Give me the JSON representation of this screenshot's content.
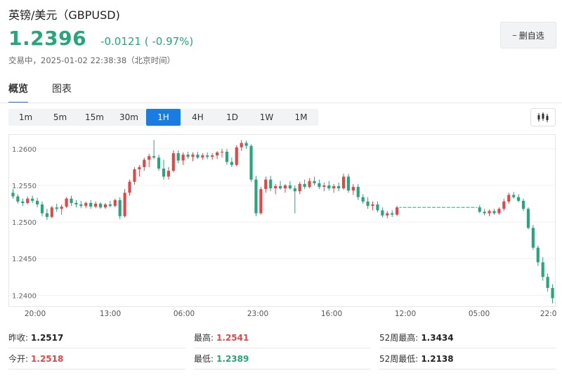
{
  "header": {
    "title": "英镑/美元（GBPUSD)",
    "price": "1.2396",
    "change": "-0.0121 ( -0.97%)",
    "status": "交易中，2025-01-02 22:38:38（北京时间）",
    "watch_button": "删自选",
    "colors": {
      "up": "#e04848",
      "down": "#27a57b",
      "accent": "#1a7be2"
    }
  },
  "tabs": [
    {
      "label": "概览",
      "active": true
    },
    {
      "label": "图表",
      "active": false
    }
  ],
  "periods": [
    "1m",
    "5m",
    "15m",
    "30m",
    "1H",
    "4H",
    "1D",
    "1W",
    "1M"
  ],
  "active_period": "1H",
  "chart_type_icon": "candlestick-icon",
  "chart_data": {
    "type": "candlestick",
    "interval": "1H",
    "ylim": [
      1.2385,
      1.262
    ],
    "y_ticks": [
      "1.2600",
      "1.2550",
      "1.2500",
      "1.2450",
      "1.2400"
    ],
    "x_ticks": [
      "20:00",
      "13:00",
      "06:00",
      "23:00",
      "16:00",
      "12:00",
      "05:00",
      "22:00"
    ],
    "grid": "horizontal",
    "series": [
      {
        "values": [
          [
            1.254,
            1.2545,
            1.2532,
            1.2535
          ],
          [
            1.2535,
            1.2538,
            1.2525,
            1.2528
          ],
          [
            1.2528,
            1.2532,
            1.2522,
            1.2526
          ],
          [
            1.2526,
            1.2535,
            1.2524,
            1.2532
          ],
          [
            1.2532,
            1.2536,
            1.2526,
            1.2529
          ],
          [
            1.2529,
            1.2533,
            1.252,
            1.2524
          ],
          [
            1.2524,
            1.2528,
            1.2508,
            1.2512
          ],
          [
            1.2512,
            1.2518,
            1.2503,
            1.2507
          ],
          [
            1.2507,
            1.2522,
            1.2505,
            1.252
          ],
          [
            1.252,
            1.2525,
            1.2514,
            1.2518
          ],
          [
            1.2518,
            1.2524,
            1.251,
            1.2521
          ],
          [
            1.2521,
            1.2534,
            1.2519,
            1.2532
          ],
          [
            1.2532,
            1.2536,
            1.2522,
            1.2526
          ],
          [
            1.2526,
            1.253,
            1.252,
            1.2524
          ],
          [
            1.2524,
            1.2529,
            1.2519,
            1.2522
          ],
          [
            1.2522,
            1.2528,
            1.2519,
            1.2526
          ],
          [
            1.2526,
            1.253,
            1.2518,
            1.2521
          ],
          [
            1.2521,
            1.2528,
            1.2519,
            1.2525
          ],
          [
            1.2525,
            1.2527,
            1.2518,
            1.252
          ],
          [
            1.252,
            1.2526,
            1.2518,
            1.2524
          ],
          [
            1.2524,
            1.2529,
            1.252,
            1.2522
          ],
          [
            1.2522,
            1.2532,
            1.252,
            1.253
          ],
          [
            1.253,
            1.2534,
            1.2504,
            1.2508
          ],
          [
            1.2508,
            1.2545,
            1.2506,
            1.254
          ],
          [
            1.254,
            1.2558,
            1.2536,
            1.2555
          ],
          [
            1.2555,
            1.2575,
            1.2551,
            1.2572
          ],
          [
            1.2572,
            1.2578,
            1.2562,
            1.2575
          ],
          [
            1.2575,
            1.2588,
            1.257,
            1.2585
          ],
          [
            1.2585,
            1.2593,
            1.2575,
            1.259
          ],
          [
            1.259,
            1.2612,
            1.2586,
            1.2588
          ],
          [
            1.2588,
            1.2592,
            1.257,
            1.2573
          ],
          [
            1.2573,
            1.2585,
            1.2558,
            1.2562
          ],
          [
            1.2562,
            1.2575,
            1.2558,
            1.257
          ],
          [
            1.257,
            1.2598,
            1.2568,
            1.2594
          ],
          [
            1.2594,
            1.2598,
            1.258,
            1.2584
          ],
          [
            1.2584,
            1.2595,
            1.2578,
            1.2592
          ],
          [
            1.2592,
            1.2596,
            1.2586,
            1.2589
          ],
          [
            1.2589,
            1.2595,
            1.2583,
            1.2592
          ],
          [
            1.2592,
            1.2596,
            1.2586,
            1.2588
          ],
          [
            1.2588,
            1.2594,
            1.2585,
            1.2591
          ],
          [
            1.2591,
            1.2595,
            1.2586,
            1.2589
          ],
          [
            1.2589,
            1.2594,
            1.2585,
            1.2591
          ],
          [
            1.2591,
            1.2597,
            1.2586,
            1.2595
          ],
          [
            1.2595,
            1.26,
            1.2588,
            1.2596
          ],
          [
            1.2596,
            1.26,
            1.2578,
            1.2582
          ],
          [
            1.2582,
            1.2588,
            1.2575,
            1.2578
          ],
          [
            1.2578,
            1.2605,
            1.2576,
            1.2602
          ],
          [
            1.2602,
            1.2612,
            1.2597,
            1.2608
          ],
          [
            1.2608,
            1.2611,
            1.26,
            1.2604
          ],
          [
            1.2604,
            1.2606,
            1.2555,
            1.2558
          ],
          [
            1.2558,
            1.2563,
            1.2508,
            1.2512
          ],
          [
            1.2512,
            1.2548,
            1.251,
            1.2545
          ],
          [
            1.2545,
            1.2562,
            1.254,
            1.2558
          ],
          [
            1.2558,
            1.2563,
            1.2542,
            1.2546
          ],
          [
            1.2546,
            1.2552,
            1.2538,
            1.2549
          ],
          [
            1.2549,
            1.2556,
            1.2544,
            1.2546
          ],
          [
            1.2546,
            1.2552,
            1.254,
            1.255
          ],
          [
            1.255,
            1.2556,
            1.2544,
            1.2546
          ],
          [
            1.2546,
            1.255,
            1.2512,
            1.2542
          ],
          [
            1.2542,
            1.2555,
            1.2538,
            1.2552
          ],
          [
            1.2552,
            1.2558,
            1.2545,
            1.2548
          ],
          [
            1.2548,
            1.256,
            1.2546,
            1.2556
          ],
          [
            1.2556,
            1.2562,
            1.255,
            1.2553
          ],
          [
            1.2553,
            1.2558,
            1.2545,
            1.2548
          ],
          [
            1.2548,
            1.2554,
            1.2542,
            1.255
          ],
          [
            1.255,
            1.2556,
            1.2543,
            1.2546
          ],
          [
            1.2546,
            1.2552,
            1.254,
            1.2549
          ],
          [
            1.2549,
            1.2554,
            1.2542,
            1.2546
          ],
          [
            1.2546,
            1.2566,
            1.2544,
            1.2562
          ],
          [
            1.2562,
            1.2566,
            1.254,
            1.2543
          ],
          [
            1.2543,
            1.2552,
            1.2537,
            1.2548
          ],
          [
            1.2548,
            1.2552,
            1.253,
            1.2534
          ],
          [
            1.2534,
            1.2538,
            1.2525,
            1.2528
          ],
          [
            1.2528,
            1.2534,
            1.2518,
            1.2522
          ],
          [
            1.2522,
            1.2528,
            1.2516,
            1.2524
          ],
          [
            1.2524,
            1.2528,
            1.2513,
            1.2516
          ],
          [
            1.2516,
            1.252,
            1.2506,
            1.2509
          ],
          [
            1.2509,
            1.2515,
            1.2505,
            1.2512
          ],
          [
            1.2512,
            1.2516,
            1.2507,
            1.251
          ],
          [
            1.251,
            1.2522,
            1.2508,
            1.252
          ],
          [
            1.252,
            1.252,
            1.252,
            1.252
          ],
          [
            1.252,
            1.252,
            1.252,
            1.252
          ],
          [
            1.252,
            1.252,
            1.252,
            1.252
          ],
          [
            1.252,
            1.252,
            1.252,
            1.252
          ],
          [
            1.252,
            1.252,
            1.252,
            1.252
          ],
          [
            1.252,
            1.252,
            1.252,
            1.252
          ],
          [
            1.252,
            1.252,
            1.252,
            1.252
          ],
          [
            1.252,
            1.252,
            1.252,
            1.252
          ],
          [
            1.252,
            1.252,
            1.252,
            1.252
          ],
          [
            1.252,
            1.252,
            1.252,
            1.252
          ],
          [
            1.252,
            1.252,
            1.252,
            1.252
          ],
          [
            1.252,
            1.252,
            1.252,
            1.252
          ],
          [
            1.252,
            1.252,
            1.252,
            1.252
          ],
          [
            1.252,
            1.252,
            1.252,
            1.252
          ],
          [
            1.252,
            1.252,
            1.252,
            1.252
          ],
          [
            1.252,
            1.252,
            1.252,
            1.252
          ],
          [
            1.252,
            1.2523,
            1.2512,
            1.2514
          ],
          [
            1.2514,
            1.2518,
            1.2509,
            1.2512
          ],
          [
            1.2512,
            1.2517,
            1.2508,
            1.2515
          ],
          [
            1.2515,
            1.2518,
            1.251,
            1.2512
          ],
          [
            1.2512,
            1.252,
            1.251,
            1.2518
          ],
          [
            1.2518,
            1.2532,
            1.2515,
            1.2528
          ],
          [
            1.2528,
            1.254,
            1.2525,
            1.2537
          ],
          [
            1.2537,
            1.2541,
            1.2532,
            1.2534
          ],
          [
            1.2534,
            1.2538,
            1.2527,
            1.2529
          ],
          [
            1.2529,
            1.2532,
            1.2515,
            1.2518
          ],
          [
            1.2518,
            1.252,
            1.249,
            1.2492
          ],
          [
            1.2492,
            1.2496,
            1.2462,
            1.2465
          ],
          [
            1.2465,
            1.2468,
            1.244,
            1.2445
          ],
          [
            1.2445,
            1.2452,
            1.242,
            1.2425
          ],
          [
            1.2425,
            1.243,
            1.2405,
            1.241
          ],
          [
            1.241,
            1.2415,
            1.2389,
            1.2396
          ]
        ]
      }
    ]
  },
  "stats": [
    [
      {
        "label": "昨收:",
        "value": "1.2517",
        "color": ""
      },
      {
        "label": "最高:",
        "value": "1.2541",
        "color": "red"
      },
      {
        "label": "52周最高:",
        "value": "1.3434",
        "color": ""
      }
    ],
    [
      {
        "label": "今开:",
        "value": "1.2518",
        "color": "red"
      },
      {
        "label": "最低:",
        "value": "1.2389",
        "color": "green"
      },
      {
        "label": "52周最低:",
        "value": "1.2138",
        "color": ""
      }
    ]
  ]
}
